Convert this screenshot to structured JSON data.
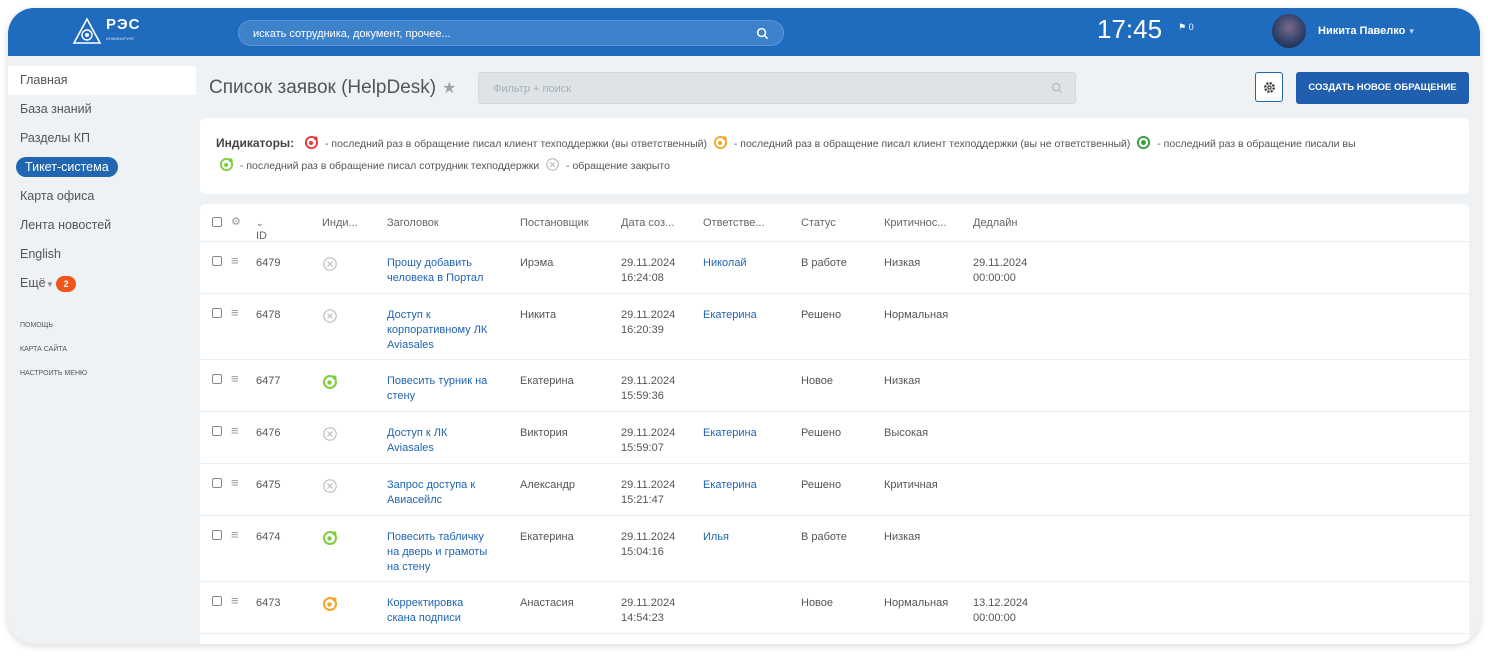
{
  "header": {
    "logo_text": "РЭС",
    "logo_sub": "ИНЖИНИРИНГ",
    "search_placeholder": "искать сотрудника, документ, прочее...",
    "clock": "17:45",
    "flag_count": "0",
    "user_name": "Никита Павелко"
  },
  "sidebar": {
    "items": [
      {
        "label": "Главная"
      },
      {
        "label": "База знаний"
      },
      {
        "label": "Разделы КП"
      },
      {
        "label": "Тикет-система"
      },
      {
        "label": "Карта офиса"
      },
      {
        "label": "Лента новостей"
      },
      {
        "label": "English"
      },
      {
        "label": "Ещё",
        "badge": "2"
      }
    ],
    "small_items": [
      "ПОМОЩЬ",
      "КАРТА САЙТА",
      "НАСТРОИТЬ МЕНЮ"
    ]
  },
  "toolbar": {
    "title": "Список заявок (HelpDesk)",
    "filter_placeholder": "Фильтр + поиск",
    "create_label": "СОЗДАТЬ НОВОЕ ОБРАЩЕНИЕ"
  },
  "indicators": {
    "label": "Индикаторы:",
    "red_text": "- последний раз в обращение писал клиент техподдержки (вы ответственный)",
    "orange_text": "- последний раз в обращение писал клиент техподдержки (вы не ответственный)",
    "green_text": "- последний раз в обращение писали вы",
    "lightgreen_text": "- последний раз в обращение писал сотрудник техподдержки",
    "closed_text": "- обращение закрыто",
    "colors": {
      "red": "#e53935",
      "orange": "#f5a623",
      "green": "#2e9e3e",
      "lightgreen": "#7ccf3a",
      "closed": "#b9bec2"
    }
  },
  "table": {
    "columns": {
      "id": "ID",
      "indicator": "Инди...",
      "title": "Заголовок",
      "author": "Постановщик",
      "date": "Дата соз...",
      "responsible": "Ответстве...",
      "status": "Статус",
      "criticality": "Критичнос...",
      "deadline": "Дедлайн"
    },
    "rows": [
      {
        "id": "6479",
        "indicator": "closed",
        "title_l1": "Прошу добавить",
        "title_l2": "человека в Портал",
        "title_l3": "",
        "author": "Ирэма",
        "date": "29.11.2024",
        "time": "16:24:08",
        "responsible": "Николай",
        "status": "В работе",
        "criticality": "Низкая",
        "deadline_date": "29.11.2024",
        "deadline_time": "00:00:00"
      },
      {
        "id": "6478",
        "indicator": "closed",
        "title_l1": "Доступ к",
        "title_l2": "корпоративному ЛК",
        "title_l3": "Aviasales",
        "author": "Никита",
        "date": "29.11.2024",
        "time": "16:20:39",
        "responsible": "Екатерина",
        "status": "Решено",
        "criticality": "Нормальная",
        "deadline_date": "",
        "deadline_time": ""
      },
      {
        "id": "6477",
        "indicator": "lightgreen",
        "title_l1": "Повесить турник на",
        "title_l2": "стену",
        "title_l3": "",
        "author": "Екатерина",
        "date": "29.11.2024",
        "time": "15:59:36",
        "responsible": "",
        "status": "Новое",
        "criticality": "Низкая",
        "deadline_date": "",
        "deadline_time": ""
      },
      {
        "id": "6476",
        "indicator": "closed",
        "title_l1": "Доступ к ЛК",
        "title_l2": "Aviasales",
        "title_l3": "",
        "author": "Виктория",
        "date": "29.11.2024",
        "time": "15:59:07",
        "responsible": "Екатерина",
        "status": "Решено",
        "criticality": "Высокая",
        "deadline_date": "",
        "deadline_time": ""
      },
      {
        "id": "6475",
        "indicator": "closed",
        "title_l1": "Запрос доступа к",
        "title_l2": "Авиасейлс",
        "title_l3": "",
        "author": "Александр",
        "date": "29.11.2024",
        "time": "15:21:47",
        "responsible": "Екатерина",
        "status": "Решено",
        "criticality": "Критичная",
        "deadline_date": "",
        "deadline_time": ""
      },
      {
        "id": "6474",
        "indicator": "lightgreen",
        "title_l1": "Повесить табличку",
        "title_l2": "на дверь и грамоты",
        "title_l3": "на стену",
        "author": "Екатерина",
        "date": "29.11.2024",
        "time": "15:04:16",
        "responsible": "Илья",
        "status": "В работе",
        "criticality": "Низкая",
        "deadline_date": "",
        "deadline_time": ""
      },
      {
        "id": "6473",
        "indicator": "orange",
        "title_l1": "Корректировка",
        "title_l2": "скана подписи",
        "title_l3": "",
        "author": "Анастасия",
        "date": "29.11.2024",
        "time": "14:54:23",
        "responsible": "",
        "status": "Новое",
        "criticality": "Нормальная",
        "deadline_date": "13.12.2024",
        "deadline_time": "00:00:00"
      }
    ]
  }
}
